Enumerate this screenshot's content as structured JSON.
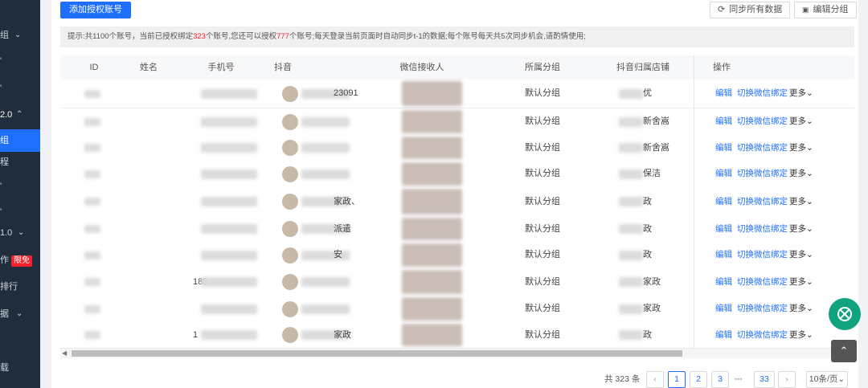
{
  "sidebar": {
    "items": [
      {
        "label": "组",
        "chev": "⌄"
      },
      {
        "label": "'",
        "chev": ""
      },
      {
        "label": "'",
        "chev": ""
      },
      {
        "label": "2.0",
        "chev": "⌃"
      },
      {
        "label": "组",
        "chev": ""
      },
      {
        "label": "程",
        "chev": ""
      },
      {
        "label": "'",
        "chev": ""
      },
      {
        "label": "'",
        "chev": ""
      },
      {
        "label": "1.0",
        "chev": "⌄"
      },
      {
        "label": "作",
        "chev": "",
        "badge": "限免"
      },
      {
        "label": "排行",
        "chev": ""
      },
      {
        "label": "据",
        "chev": "⌄"
      },
      {
        "label": "载",
        "chev": ""
      }
    ]
  },
  "toolbar": {
    "add_label": "添加授权账号",
    "sync_label": "同步所有数据",
    "edit_group_label": "编辑分组"
  },
  "notice": {
    "p1": "提示:共1100个账号，当前已授权绑定",
    "bound": "323",
    "p2": "个账号,您还可以授权",
    "remain": "777",
    "p3": "个账号;每天登录当前页面时自动同步t-1的数据;每个账号每天共5次同步机会,请酌情使用;"
  },
  "table": {
    "headers": [
      "ID",
      "姓名",
      "手机号",
      "抖音",
      "微信接收人",
      "所属分组",
      "抖音归属店铺",
      "操作"
    ],
    "rows": [
      {
        "douyin": "23091",
        "group": "默认分组",
        "shop": "优"
      },
      {
        "douyin": "",
        "group": "默认分组",
        "shop": "新舍嵩"
      },
      {
        "douyin": "",
        "group": "默认分组",
        "shop": "新舍嵩"
      },
      {
        "douyin": "",
        "group": "默认分组",
        "shop": "保洁"
      },
      {
        "douyin": "家政、",
        "group": "默认分组",
        "shop": "政"
      },
      {
        "douyin": "派遣",
        "group": "默认分组",
        "shop": "政"
      },
      {
        "douyin": "安",
        "group": "默认分组",
        "shop": "政"
      },
      {
        "phone": "185",
        "group": "默认分组",
        "shop": "家政"
      },
      {
        "douyin": "",
        "group": "默认分组",
        "shop": "家政"
      },
      {
        "phone": "1",
        "douyin": "家政",
        "group": "默认分组",
        "shop": "政"
      }
    ],
    "ops": {
      "edit": "编辑",
      "switch": "切换微信绑定",
      "more": "更多⌄"
    }
  },
  "pagination": {
    "total": "共 323 条",
    "pages": [
      "1",
      "2",
      "3"
    ],
    "ellipsis": "•••",
    "last": "33",
    "size": "10条/页⌄",
    "prev": "‹",
    "next": "›"
  },
  "floating": {
    "top_icon": "⌃"
  }
}
